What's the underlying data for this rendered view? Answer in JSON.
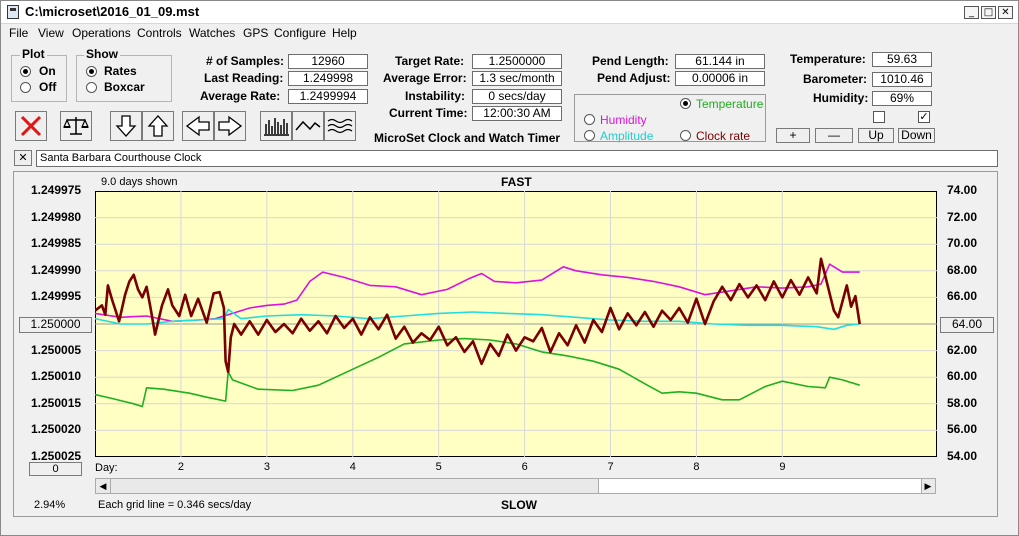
{
  "window": {
    "title": "C:\\microset\\2016_01_09.mst"
  },
  "menu": [
    "File",
    "View",
    "Operations",
    "Controls",
    "Watches",
    "GPS",
    "Configure",
    "Help"
  ],
  "window_buttons": {
    "minimize": "_",
    "maximize": "□",
    "close": "✕"
  },
  "plot_group": {
    "title": "Plot",
    "options": [
      "On",
      "Off"
    ],
    "selected": 0
  },
  "show_group": {
    "title": "Show",
    "options": [
      "Rates",
      "Boxcar"
    ],
    "selected": 0
  },
  "stats": {
    "samples_label": "# of Samples:",
    "samples": "12960",
    "last_reading_label": "Last Reading:",
    "last_reading": "1.249998",
    "average_rate_label": "Average Rate:",
    "average_rate": "1.2499994",
    "target_rate_label": "Target Rate:",
    "target_rate": "1.2500000",
    "average_error_label": "Average Error:",
    "average_error": "1.3 sec/month",
    "instability_label": "Instability:",
    "instability": "0 secs/day",
    "current_time_label": "Current Time:",
    "current_time": "12:00:30 AM",
    "pend_length_label": "Pend Length:",
    "pend_length": "61.144 in",
    "pend_adjust_label": "Pend Adjust:",
    "pend_adjust": "0.00006 in",
    "temperature_label": "Temperature:",
    "temperature": "59.63",
    "barometer_label": "Barometer:",
    "barometer": "1010.46",
    "humidity_label": "Humidity:",
    "humidity": "69%"
  },
  "app_caption": "MicroSet Clock and Watch Timer",
  "overlay_options": {
    "temperature": "Temperature",
    "humidity": "Humidity",
    "amplitude": "Amplitude",
    "clock_rate": "Clock rate",
    "selected": "temperature"
  },
  "scale_buttons": {
    "plus": "+",
    "minus": "—",
    "up": "Up",
    "down": "Down"
  },
  "checkboxes": [
    false,
    true
  ],
  "clock_name": "Santa Barbara Courthouse Clock",
  "clear_button": "✕",
  "colors": {
    "rate": "#7a0000",
    "temperature": "#1faf1f",
    "humidity": "#dd11dd",
    "amplitude": "#22dddd",
    "plot_bg": "#ffffc4"
  },
  "chart_data": {
    "type": "line",
    "title": "FAST",
    "bottom_label": "SLOW",
    "days_shown": "9.0 days shown",
    "x_axis_label": "Day:",
    "x_ticks": [
      2,
      3,
      4,
      5,
      6,
      7,
      8,
      9
    ],
    "xlim": [
      1,
      10.8
    ],
    "left_axis": {
      "ticks": [
        "1.249975",
        "1.249980",
        "1.249985",
        "1.249990",
        "1.249995",
        "1.250000",
        "1.250005",
        "1.250010",
        "1.250015",
        "1.250020",
        "1.250025"
      ],
      "ylim": [
        1.249975,
        1.250025
      ],
      "inverted": true,
      "center_value": "1.250000"
    },
    "right_axis": {
      "ticks": [
        "74.00",
        "72.00",
        "70.00",
        "68.00",
        "66.00",
        "64.00",
        "62.00",
        "60.00",
        "58.00",
        "56.00",
        "54.00"
      ],
      "ylim": [
        54,
        74
      ],
      "center_value": "64.00"
    },
    "footer": {
      "percent": "2.94%",
      "grid_note": "Each grid line = 0.346 secs/day",
      "left_box": "0"
    },
    "series": [
      {
        "name": "Temperature",
        "axis": "right",
        "points": [
          [
            1,
            58.7
          ],
          [
            1.2,
            58.4
          ],
          [
            1.45,
            58.0
          ],
          [
            1.55,
            57.8
          ],
          [
            1.6,
            59.2
          ],
          [
            1.8,
            59.1
          ],
          [
            2.1,
            58.8
          ],
          [
            2.3,
            58.5
          ],
          [
            2.52,
            58.2
          ],
          [
            2.55,
            60.4
          ],
          [
            2.6,
            59.8
          ],
          [
            2.9,
            59.1
          ],
          [
            3.3,
            59.0
          ],
          [
            3.6,
            59.4
          ],
          [
            3.9,
            60.3
          ],
          [
            4.3,
            61.5
          ],
          [
            4.6,
            62.5
          ],
          [
            5.0,
            62.8
          ],
          [
            5.3,
            62.9
          ],
          [
            5.6,
            62.8
          ],
          [
            5.9,
            62.5
          ],
          [
            6.2,
            61.9
          ],
          [
            6.5,
            61.6
          ],
          [
            6.8,
            61.2
          ],
          [
            7.1,
            60.6
          ],
          [
            7.4,
            59.5
          ],
          [
            7.6,
            58.8
          ],
          [
            7.8,
            58.9
          ],
          [
            8.0,
            58.8
          ],
          [
            8.3,
            58.3
          ],
          [
            8.5,
            58.3
          ],
          [
            8.8,
            59.3
          ],
          [
            9.0,
            59.7
          ],
          [
            9.3,
            59.3
          ],
          [
            9.5,
            59.2
          ],
          [
            9.55,
            60.0
          ],
          [
            9.7,
            59.8
          ],
          [
            9.9,
            59.4
          ]
        ]
      },
      {
        "name": "Humidity",
        "axis": "right",
        "points": [
          [
            1,
            64.8
          ],
          [
            1.3,
            64.5
          ],
          [
            1.6,
            64.6
          ],
          [
            1.9,
            64.2
          ],
          [
            2.2,
            64.3
          ],
          [
            2.4,
            64.4
          ],
          [
            2.6,
            64.8
          ],
          [
            2.8,
            65.2
          ],
          [
            3.0,
            65.4
          ],
          [
            3.2,
            65.5
          ],
          [
            3.35,
            65.8
          ],
          [
            3.5,
            67.2
          ],
          [
            3.65,
            67.9
          ],
          [
            3.9,
            67.5
          ],
          [
            4.2,
            66.9
          ],
          [
            4.5,
            66.8
          ],
          [
            4.8,
            66.2
          ],
          [
            5.1,
            66.6
          ],
          [
            5.35,
            67.4
          ],
          [
            5.5,
            67.8
          ],
          [
            5.65,
            67.2
          ],
          [
            5.9,
            67.1
          ],
          [
            6.2,
            67.3
          ],
          [
            6.45,
            68.3
          ],
          [
            6.6,
            68.0
          ],
          [
            6.9,
            67.7
          ],
          [
            7.2,
            67.5
          ],
          [
            7.5,
            67.2
          ],
          [
            7.8,
            66.8
          ],
          [
            8.1,
            66.2
          ],
          [
            8.4,
            66.5
          ],
          [
            8.7,
            66.8
          ],
          [
            9.0,
            66.7
          ],
          [
            9.3,
            66.8
          ],
          [
            9.45,
            67.0
          ],
          [
            9.55,
            68.5
          ],
          [
            9.7,
            67.9
          ],
          [
            9.9,
            67.9
          ]
        ]
      },
      {
        "name": "Amplitude",
        "axis": "right",
        "points": [
          [
            1,
            64.4
          ],
          [
            1.3,
            64.0
          ],
          [
            1.6,
            64.0
          ],
          [
            1.9,
            64.2
          ],
          [
            2.2,
            64.3
          ],
          [
            2.5,
            64.4
          ],
          [
            2.55,
            65.1
          ],
          [
            2.7,
            64.4
          ],
          [
            3.0,
            64.6
          ],
          [
            3.4,
            64.7
          ],
          [
            3.8,
            64.6
          ],
          [
            4.2,
            64.4
          ],
          [
            4.6,
            64.6
          ],
          [
            5.0,
            64.8
          ],
          [
            5.4,
            64.9
          ],
          [
            5.8,
            64.8
          ],
          [
            6.2,
            64.7
          ],
          [
            6.6,
            64.5
          ],
          [
            7.0,
            64.3
          ],
          [
            7.4,
            64.2
          ],
          [
            7.8,
            64.2
          ],
          [
            8.2,
            64.0
          ],
          [
            8.6,
            63.9
          ],
          [
            9.0,
            63.9
          ],
          [
            9.4,
            63.8
          ],
          [
            9.6,
            63.6
          ],
          [
            9.75,
            63.9
          ],
          [
            9.9,
            64.0
          ]
        ]
      },
      {
        "name": "Clock rate",
        "axis": "right",
        "points": [
          [
            1,
            65.0
          ],
          [
            1.08,
            65.4
          ],
          [
            1.12,
            64.7
          ],
          [
            1.15,
            66.9
          ],
          [
            1.2,
            65.8
          ],
          [
            1.28,
            64.2
          ],
          [
            1.35,
            66.2
          ],
          [
            1.4,
            67.2
          ],
          [
            1.45,
            67.7
          ],
          [
            1.5,
            66.6
          ],
          [
            1.55,
            66.0
          ],
          [
            1.6,
            66.8
          ],
          [
            1.65,
            65.1
          ],
          [
            1.7,
            63.2
          ],
          [
            1.78,
            65.4
          ],
          [
            1.85,
            66.6
          ],
          [
            1.9,
            65.4
          ],
          [
            1.98,
            64.6
          ],
          [
            2.05,
            66.2
          ],
          [
            2.12,
            64.6
          ],
          [
            2.2,
            65.9
          ],
          [
            2.3,
            64.1
          ],
          [
            2.38,
            66.3
          ],
          [
            2.45,
            66.4
          ],
          [
            2.5,
            65.2
          ],
          [
            2.52,
            61.2
          ],
          [
            2.55,
            60.4
          ],
          [
            2.58,
            63.0
          ],
          [
            2.62,
            64.0
          ],
          [
            2.7,
            63.2
          ],
          [
            2.8,
            64.2
          ],
          [
            2.9,
            63.2
          ],
          [
            3.0,
            64.3
          ],
          [
            3.1,
            63.4
          ],
          [
            3.2,
            64.0
          ],
          [
            3.3,
            63.3
          ],
          [
            3.4,
            64.4
          ],
          [
            3.5,
            63.5
          ],
          [
            3.6,
            64.2
          ],
          [
            3.7,
            63.3
          ],
          [
            3.8,
            64.6
          ],
          [
            3.9,
            63.7
          ],
          [
            4.0,
            64.4
          ],
          [
            4.1,
            63.2
          ],
          [
            4.2,
            64.5
          ],
          [
            4.3,
            63.6
          ],
          [
            4.4,
            64.7
          ],
          [
            4.5,
            62.9
          ],
          [
            4.6,
            63.8
          ],
          [
            4.7,
            62.6
          ],
          [
            4.8,
            63.3
          ],
          [
            4.9,
            62.8
          ],
          [
            5.0,
            63.8
          ],
          [
            5.1,
            62.4
          ],
          [
            5.2,
            63.0
          ],
          [
            5.3,
            61.9
          ],
          [
            5.4,
            62.7
          ],
          [
            5.5,
            61.0
          ],
          [
            5.6,
            62.5
          ],
          [
            5.7,
            61.6
          ],
          [
            5.8,
            63.2
          ],
          [
            5.9,
            62.0
          ],
          [
            6.0,
            63.0
          ],
          [
            6.1,
            62.7
          ],
          [
            6.2,
            63.7
          ],
          [
            6.3,
            61.9
          ],
          [
            6.4,
            63.3
          ],
          [
            6.5,
            62.4
          ],
          [
            6.6,
            63.9
          ],
          [
            6.7,
            62.6
          ],
          [
            6.8,
            64.3
          ],
          [
            6.9,
            63.4
          ],
          [
            7.0,
            65.2
          ],
          [
            7.1,
            63.6
          ],
          [
            7.2,
            64.8
          ],
          [
            7.3,
            63.9
          ],
          [
            7.4,
            64.9
          ],
          [
            7.5,
            63.8
          ],
          [
            7.6,
            65.0
          ],
          [
            7.7,
            64.3
          ],
          [
            7.8,
            65.2
          ],
          [
            7.9,
            64.1
          ],
          [
            8.0,
            65.9
          ],
          [
            8.1,
            64.0
          ],
          [
            8.2,
            65.7
          ],
          [
            8.3,
            66.8
          ],
          [
            8.4,
            65.8
          ],
          [
            8.5,
            67.0
          ],
          [
            8.6,
            66.0
          ],
          [
            8.7,
            66.9
          ],
          [
            8.8,
            65.8
          ],
          [
            8.9,
            67.2
          ],
          [
            9.0,
            66.0
          ],
          [
            9.1,
            67.3
          ],
          [
            9.2,
            66.2
          ],
          [
            9.3,
            67.5
          ],
          [
            9.4,
            66.3
          ],
          [
            9.45,
            68.9
          ],
          [
            9.5,
            67.6
          ],
          [
            9.6,
            65.0
          ],
          [
            9.65,
            64.5
          ],
          [
            9.75,
            66.9
          ],
          [
            9.8,
            65.3
          ],
          [
            9.85,
            66.1
          ],
          [
            9.9,
            64.0
          ]
        ]
      }
    ]
  }
}
